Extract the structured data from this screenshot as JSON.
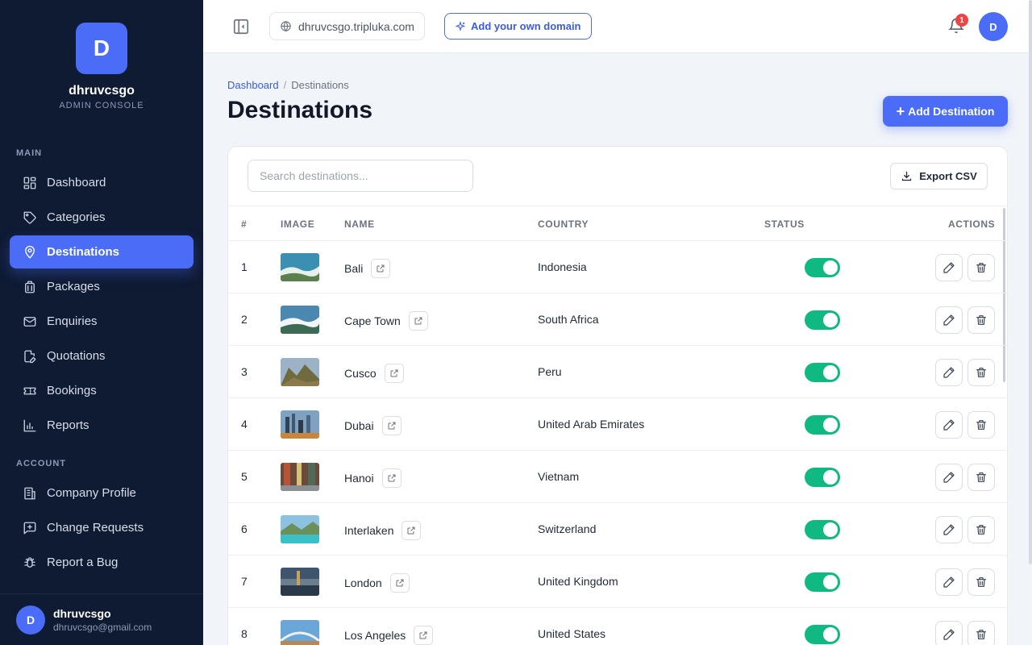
{
  "brand": {
    "initial": "D",
    "name": "dhruvcsgo",
    "subtitle": "ADMIN CONSOLE"
  },
  "sidebar": {
    "main_label": "MAIN",
    "account_label": "ACCOUNT",
    "main_items": [
      {
        "label": "Dashboard",
        "icon": "grid-icon"
      },
      {
        "label": "Categories",
        "icon": "tag-icon"
      },
      {
        "label": "Destinations",
        "icon": "map-pin-icon",
        "active": true
      },
      {
        "label": "Packages",
        "icon": "luggage-icon"
      },
      {
        "label": "Enquiries",
        "icon": "mail-icon"
      },
      {
        "label": "Quotations",
        "icon": "document-edit-icon"
      },
      {
        "label": "Bookings",
        "icon": "ticket-icon"
      },
      {
        "label": "Reports",
        "icon": "bar-chart-icon"
      }
    ],
    "account_items": [
      {
        "label": "Company Profile",
        "icon": "building-icon"
      },
      {
        "label": "Change Requests",
        "icon": "message-plus-icon"
      },
      {
        "label": "Report a Bug",
        "icon": "bug-icon"
      }
    ]
  },
  "user": {
    "initial": "D",
    "name": "dhruvcsgo",
    "email": "dhruvcsgo@gmail.com"
  },
  "topbar": {
    "domain": "dhruvcsgo.tripluka.com",
    "add_domain_label": "Add your own domain",
    "notification_count": "1",
    "avatar_initial": "D"
  },
  "breadcrumb": {
    "parent": "Dashboard",
    "separator": "/",
    "current": "Destinations"
  },
  "page": {
    "title": "Destinations",
    "add_button": "Add Destination"
  },
  "toolbar": {
    "search_placeholder": "Search destinations...",
    "export_label": "Export CSV"
  },
  "table": {
    "headers": {
      "num": "#",
      "image": "IMAGE",
      "name": "NAME",
      "country": "COUNTRY",
      "status": "STATUS",
      "actions": "ACTIONS"
    },
    "rows": [
      {
        "num": "1",
        "name": "Bali",
        "country": "Indonesia",
        "active": true
      },
      {
        "num": "2",
        "name": "Cape Town",
        "country": "South Africa",
        "active": true
      },
      {
        "num": "3",
        "name": "Cusco",
        "country": "Peru",
        "active": true
      },
      {
        "num": "4",
        "name": "Dubai",
        "country": "United Arab Emirates",
        "active": true
      },
      {
        "num": "5",
        "name": "Hanoi",
        "country": "Vietnam",
        "active": true
      },
      {
        "num": "6",
        "name": "Interlaken",
        "country": "Switzerland",
        "active": true
      },
      {
        "num": "7",
        "name": "London",
        "country": "United Kingdom",
        "active": true
      },
      {
        "num": "8",
        "name": "Los Angeles",
        "country": "United States",
        "active": true
      }
    ]
  },
  "colors": {
    "accent": "#4a6cf7",
    "sidebar_bg": "#0f1a33",
    "toggle_on": "#10b981",
    "badge": "#ef4444"
  }
}
